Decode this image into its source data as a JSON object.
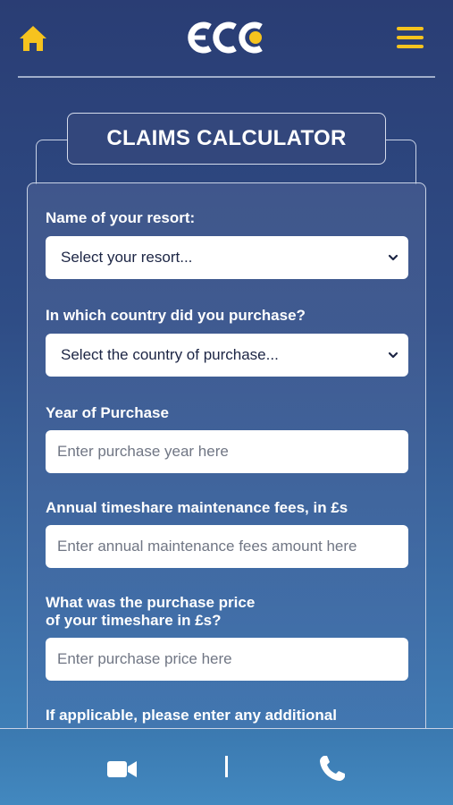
{
  "header": {
    "home_icon": "home-icon",
    "logo_text": "ECC",
    "menu_icon": "hamburger-icon",
    "accent_color": "#f6c31e"
  },
  "title": "CLAIMS CALCULATOR",
  "form": {
    "resort": {
      "label": "Name of your resort:",
      "selected": "Select your resort..."
    },
    "country": {
      "label": "In which country did you purchase?",
      "selected": "Select the country of purchase..."
    },
    "year": {
      "label": "Year of Purchase",
      "placeholder": "Enter purchase year here"
    },
    "fees": {
      "label": "Annual timeshare maintenance fees, in £s",
      "placeholder": "Enter annual maintenance fees amount here"
    },
    "price": {
      "label_line1": "What was the purchase price",
      "label_line2": "of your timeshare in £s?",
      "placeholder": "Enter purchase price here"
    },
    "additional": {
      "label_line1": "If applicable, please enter any additional"
    }
  },
  "footer": {
    "video_icon": "video-camera-icon",
    "phone_icon": "phone-icon"
  }
}
